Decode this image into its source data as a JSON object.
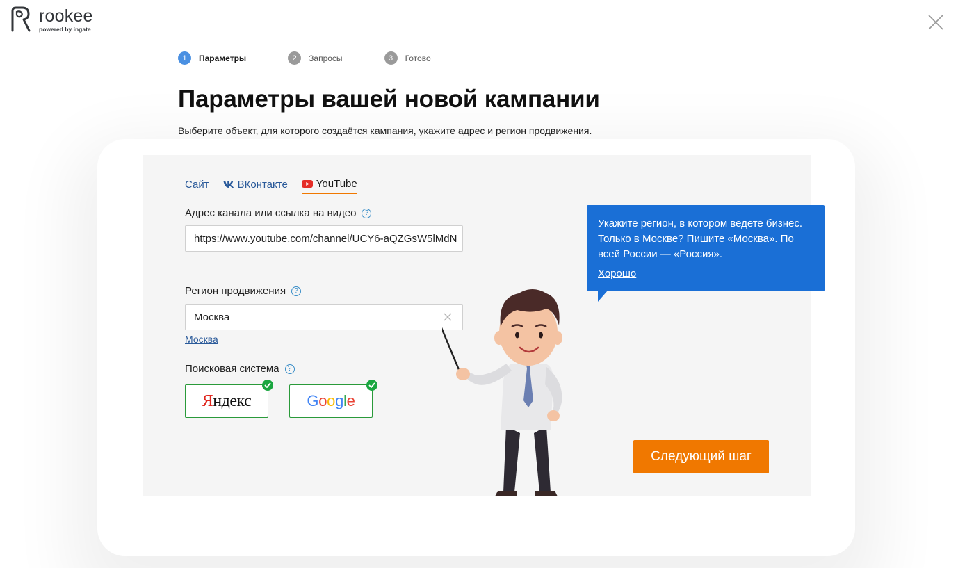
{
  "brand": {
    "name": "rookee",
    "tagline": "powered by ingate"
  },
  "stepper": [
    {
      "num": "1",
      "label": "Параметры"
    },
    {
      "num": "2",
      "label": "Запросы"
    },
    {
      "num": "3",
      "label": "Готово"
    }
  ],
  "page": {
    "title": "Параметры вашей новой кампании",
    "subtitle": "Выберите объект, для которого создаётся кампания, укажите адрес и регион продвижения."
  },
  "tabs": [
    {
      "label": "Сайт",
      "icon": ""
    },
    {
      "label": "ВКонтакте",
      "icon": "vk-icon"
    },
    {
      "label": "YouTube",
      "icon": "youtube-icon",
      "active": true
    }
  ],
  "fields": {
    "channel": {
      "label": "Адрес канала или ссылка на видео",
      "value": "https://www.youtube.com/channel/UCY6-aQZGsW5lMdN"
    },
    "region": {
      "label": "Регион продвижения",
      "value": "Москва",
      "suggestion": "Москва"
    },
    "engine": {
      "label": "Поисковая система",
      "options": [
        "Яндекс",
        "Google"
      ]
    }
  },
  "next_button": "Следующий шаг",
  "tooltip": {
    "text": "Укажите регион, в котором ведете бизнес. Только в Москве? Пишите «Москва». По всей России — «Россия».",
    "ok": "Хорошо"
  },
  "colors": {
    "accent": "#f07800",
    "link": "#2a5a9a",
    "tooltip": "#1a6fd6",
    "check": "#1aa640",
    "step_active": "#4a90e2"
  }
}
